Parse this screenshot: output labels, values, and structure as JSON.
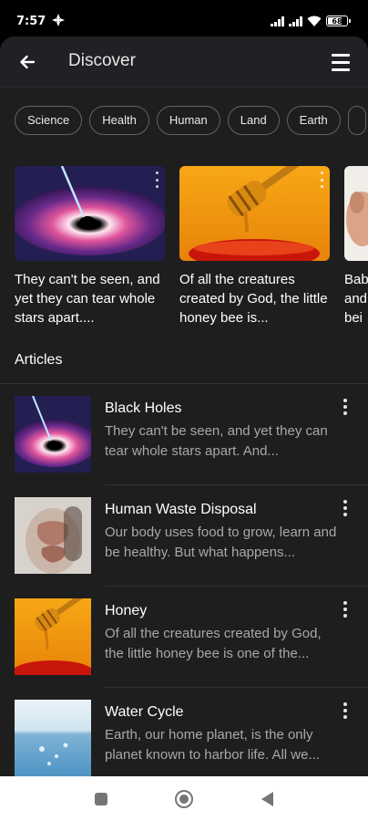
{
  "status_bar": {
    "time": "7:57",
    "battery_level": "68",
    "battery_fraction": 0.68
  },
  "header": {
    "title": "Discover",
    "back_icon": "arrow-left-icon",
    "menu_icon": "hamburger-menu-icon"
  },
  "chips": [
    "Science",
    "Health",
    "Human",
    "Land",
    "Earth"
  ],
  "featured": [
    {
      "text": "They can't be seen, and yet they can tear whole stars apart....",
      "image": "black-hole"
    },
    {
      "text": "Of all the creatures created by God, the little honey bee is...",
      "image": "honey"
    },
    {
      "text": "Bab\nand\nbei",
      "image": "baby"
    }
  ],
  "articles_section_title": "Articles",
  "articles": [
    {
      "title": "Black Holes",
      "snippet": "They can't be seen, and yet they can tear whole stars apart. And...",
      "image": "black-hole"
    },
    {
      "title": "Human Waste Disposal",
      "snippet": "Our body uses food to grow, learn and be healthy. But what happens...",
      "image": "digestive"
    },
    {
      "title": "Honey",
      "snippet": "Of all the creatures created by God, the little honey bee is one of the...",
      "image": "honey"
    },
    {
      "title": "Water Cycle",
      "snippet": "Earth, our home planet, is the only planet known to harbor life. All we...",
      "image": "water"
    }
  ],
  "colors": {
    "background": "#1e1e1e",
    "app_bar": "#202124",
    "chip_border": "#5f6368",
    "snippet_text": "#a8a8a8",
    "nav_bar": "#ffffff"
  }
}
